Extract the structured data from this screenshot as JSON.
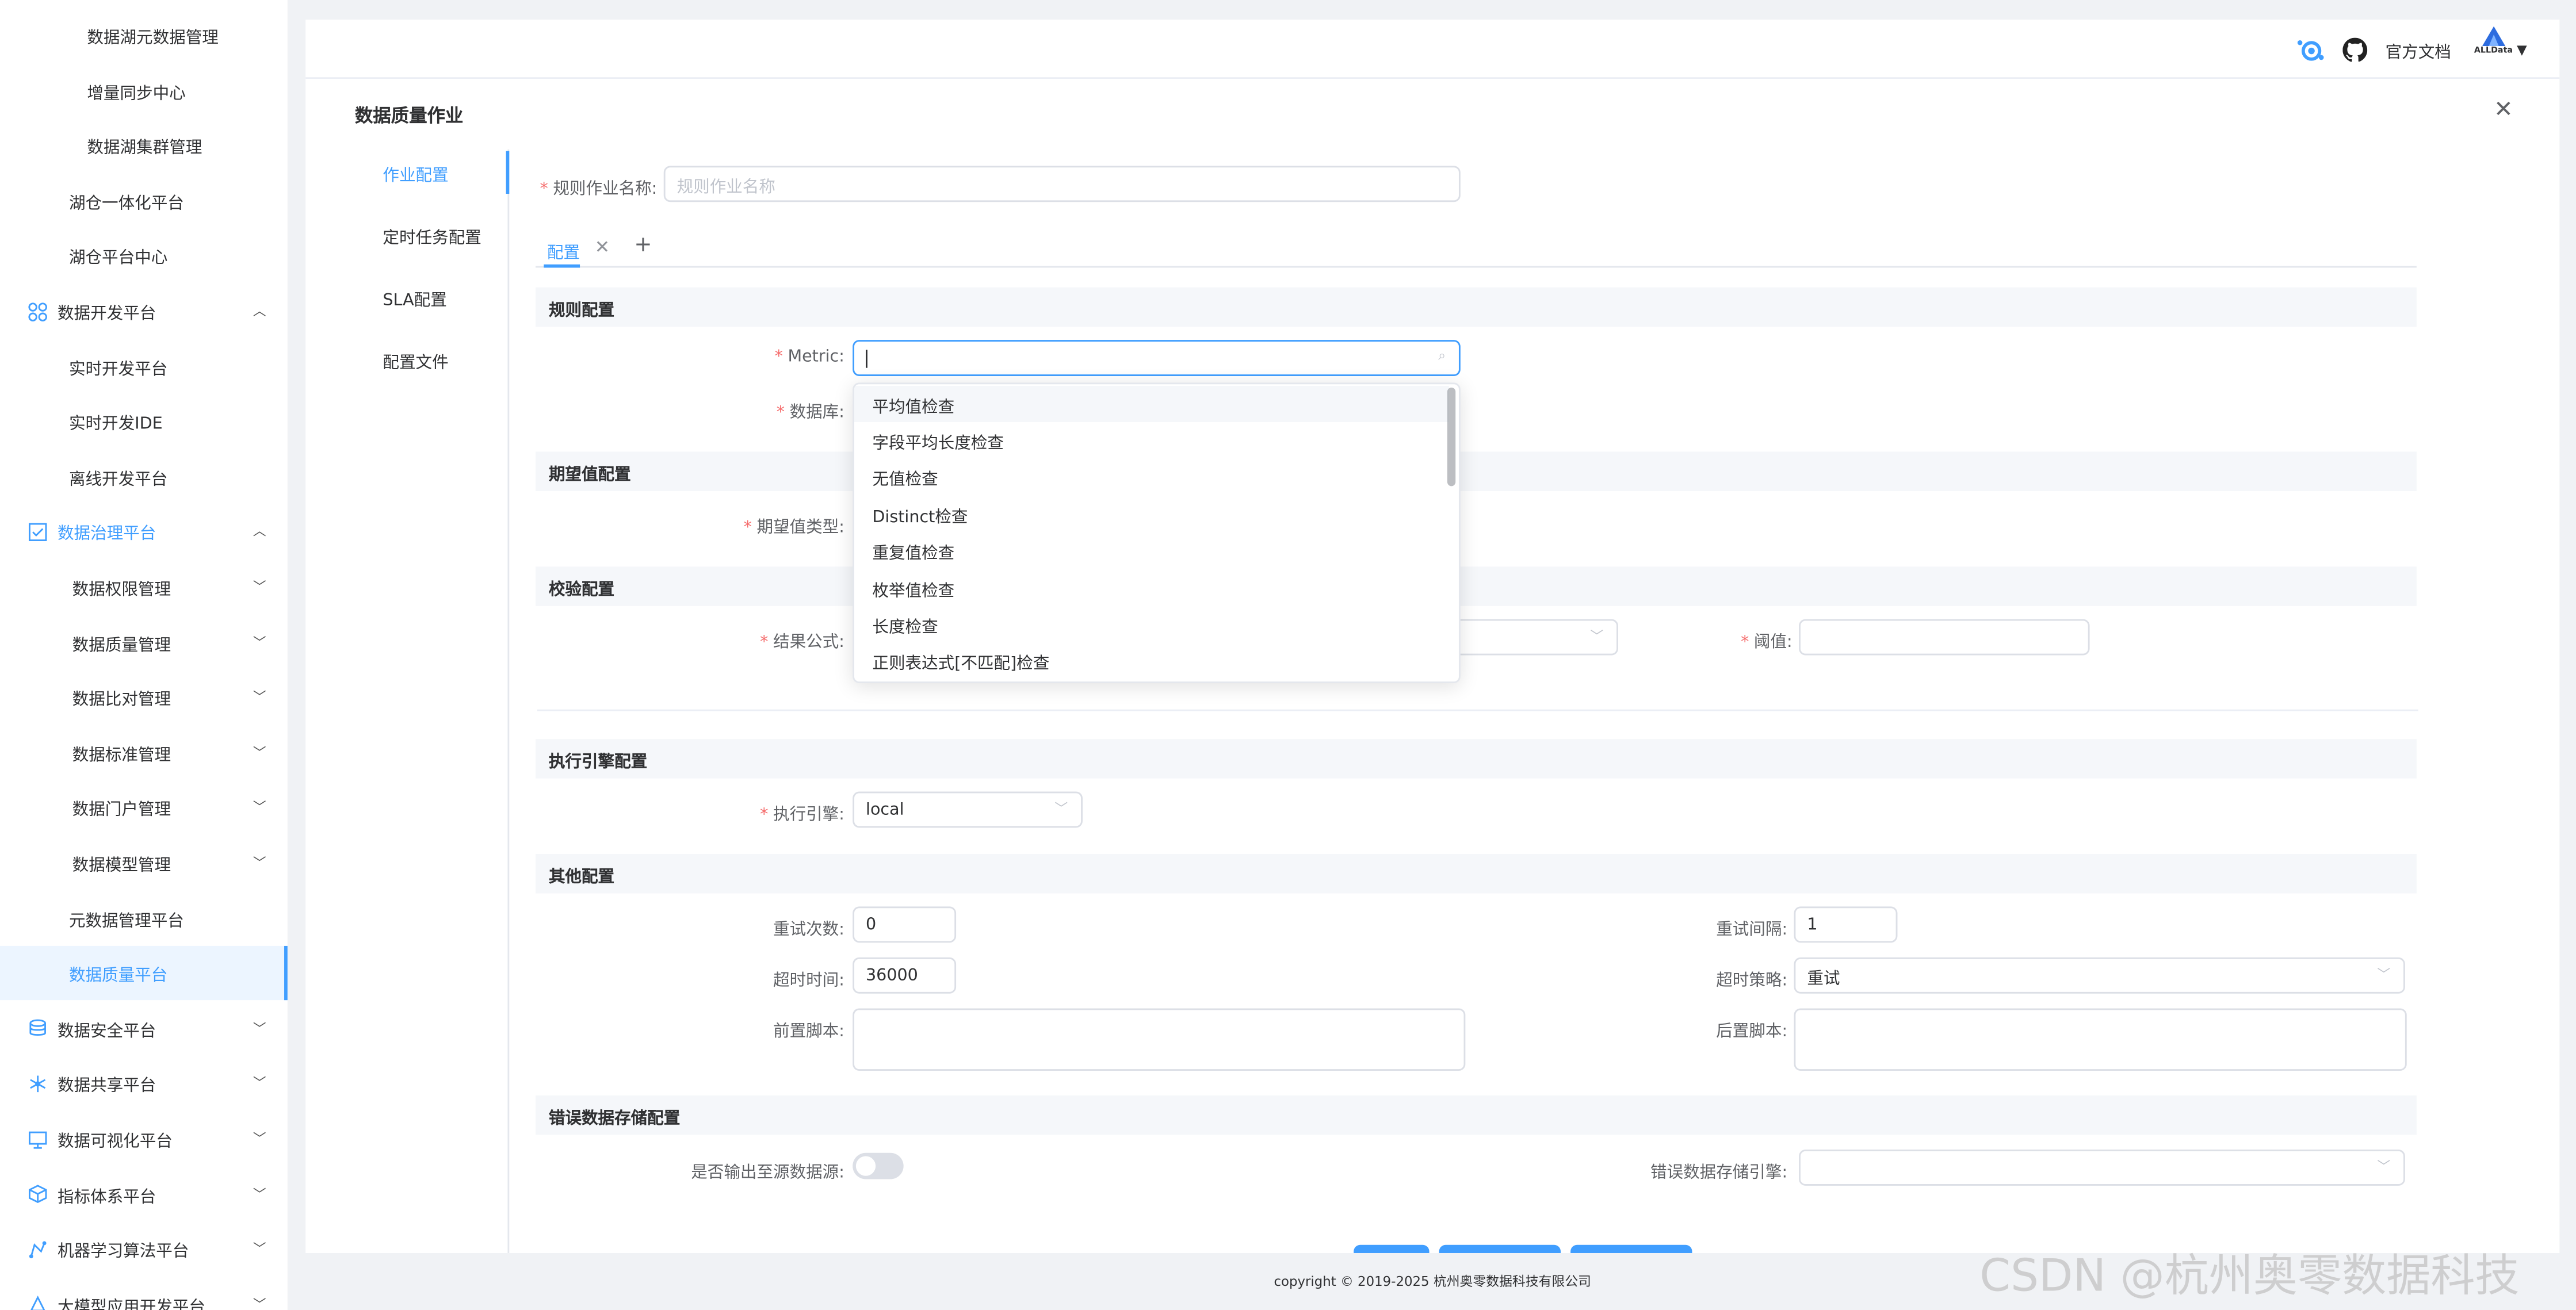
{
  "sidebar": {
    "items": [
      {
        "label": "数据湖元数据管理",
        "level": 3
      },
      {
        "label": "增量同步中心",
        "level": 3
      },
      {
        "label": "数据湖集群管理",
        "level": 3
      },
      {
        "label": "湖仓一体化平台",
        "level": 2
      },
      {
        "label": "湖仓平台中心",
        "level": 2
      },
      {
        "label": "数据开发平台",
        "level": 1,
        "icon": "apps-icon",
        "expanded": true
      },
      {
        "label": "实时开发平台",
        "level": 2
      },
      {
        "label": "实时开发IDE",
        "level": 2
      },
      {
        "label": "离线开发平台",
        "level": 2
      },
      {
        "label": "数据治理平台",
        "level": 1,
        "icon": "checkbox-icon",
        "expanded": true,
        "highlight": true
      },
      {
        "label": "数据权限管理",
        "level": 2,
        "chevron": true
      },
      {
        "label": "数据质量管理",
        "level": 2,
        "chevron": true
      },
      {
        "label": "数据比对管理",
        "level": 2,
        "chevron": true
      },
      {
        "label": "数据标准管理",
        "level": 2,
        "chevron": true
      },
      {
        "label": "数据门户管理",
        "level": 2,
        "chevron": true
      },
      {
        "label": "数据模型管理",
        "level": 2,
        "chevron": true
      },
      {
        "label": "元数据管理平台",
        "level": 2
      },
      {
        "label": "数据质量平台",
        "level": 2,
        "active": true
      },
      {
        "label": "数据安全平台",
        "level": 1,
        "icon": "database-icon",
        "chevron": true
      },
      {
        "label": "数据共享平台",
        "level": 1,
        "icon": "share-icon",
        "chevron": true
      },
      {
        "label": "数据可视化平台",
        "level": 1,
        "icon": "monitor-icon",
        "chevron": true
      },
      {
        "label": "指标体系平台",
        "level": 1,
        "icon": "cube-icon",
        "chevron": true
      },
      {
        "label": "机器学习算法平台",
        "level": 1,
        "icon": "graph-icon",
        "chevron": true
      },
      {
        "label": "大模型应用开发平台",
        "level": 1,
        "icon": "model-icon",
        "chevron": true
      }
    ]
  },
  "header": {
    "docs_label": "官方文档",
    "brand": "ALLData"
  },
  "page": {
    "title": "数据质量作业",
    "vtabs": [
      "作业配置",
      "定时任务配置",
      "SLA配置",
      "配置文件"
    ],
    "job_name_label": "规则作业名称:",
    "job_name_placeholder": "规则作业名称",
    "config_tab": "配置",
    "sections": {
      "rule": "规则配置",
      "expect": "期望值配置",
      "check": "校验配置",
      "engine": "执行引擎配置",
      "other": "其他配置",
      "error": "错误数据存储配置"
    },
    "fields": {
      "metric_label": "Metric:",
      "database_label": "数据库:",
      "expect_type_label": "期望值类型:",
      "formula_label": "结果公式:",
      "threshold_label": "阈值:",
      "engine_label": "执行引擎:",
      "engine_value": "local",
      "retry_label": "重试次数:",
      "retry_value": "0",
      "retry_interval_label": "重试间隔:",
      "retry_interval_value": "1",
      "timeout_label": "超时时间:",
      "timeout_value": "36000",
      "timeout_policy_label": "超时策略:",
      "timeout_policy_value": "重试",
      "pre_script_label": "前置脚本:",
      "post_script_label": "后置脚本:",
      "output_source_label": "是否输出至源数据源:",
      "error_engine_label": "错误数据存储引擎:"
    },
    "metric_options": [
      "平均值检查",
      "字段平均长度检查",
      "无值检查",
      "Distinct检查",
      "重复值检查",
      "枚举值检查",
      "长度检查",
      "正则表达式[不匹配]检查"
    ]
  },
  "footer": {
    "copyright": "copyright © 2019-2025 杭州奥零数据科技有限公司"
  },
  "watermark": "CSDN @杭州奥零数据科技",
  "colors": {
    "accent": "#409eff",
    "required": "#f56c6c"
  }
}
